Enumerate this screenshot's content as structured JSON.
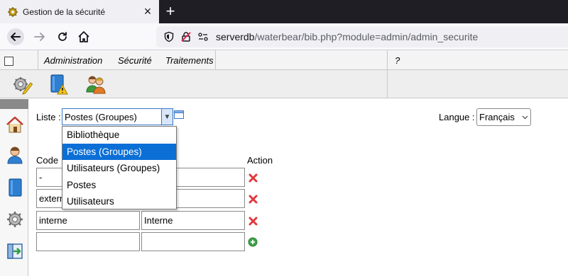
{
  "browser": {
    "tab_title": "Gestion de la sécurité",
    "url_host": "serverdb",
    "url_path": "/waterbear/bib.php?module=admin/admin_securite"
  },
  "menubar": {
    "items": [
      "Administration",
      "Sécurité",
      "Traitements"
    ],
    "help": "?"
  },
  "form": {
    "liste_label": "Liste :",
    "liste_value": "Postes (Groupes)",
    "langue_label": "Langue :",
    "langue_value": "Français",
    "dropdown_options": [
      "Bibliothèque",
      "Postes (Groupes)",
      "Utilisateurs (Groupes)",
      "Postes",
      "Utilisateurs"
    ],
    "selected_option_index": 1
  },
  "table": {
    "col_code": "Code",
    "col_action": "Action",
    "rows": [
      {
        "code": "-",
        "label": ""
      },
      {
        "code": "extern",
        "label": ""
      },
      {
        "code": "interne",
        "label": "Interne"
      },
      {
        "code": "",
        "label": ""
      }
    ]
  },
  "colors": {
    "selection": "#0b6fd6",
    "delete": "#e0393e",
    "add": "#3fa54a"
  },
  "icons": {
    "toolbar": [
      "settings-pencil-icon",
      "book-warning-icon",
      "users-icon"
    ],
    "sidebar": [
      "home-icon",
      "user-icon",
      "book-icon",
      "settings-icon",
      "exit-icon"
    ]
  }
}
